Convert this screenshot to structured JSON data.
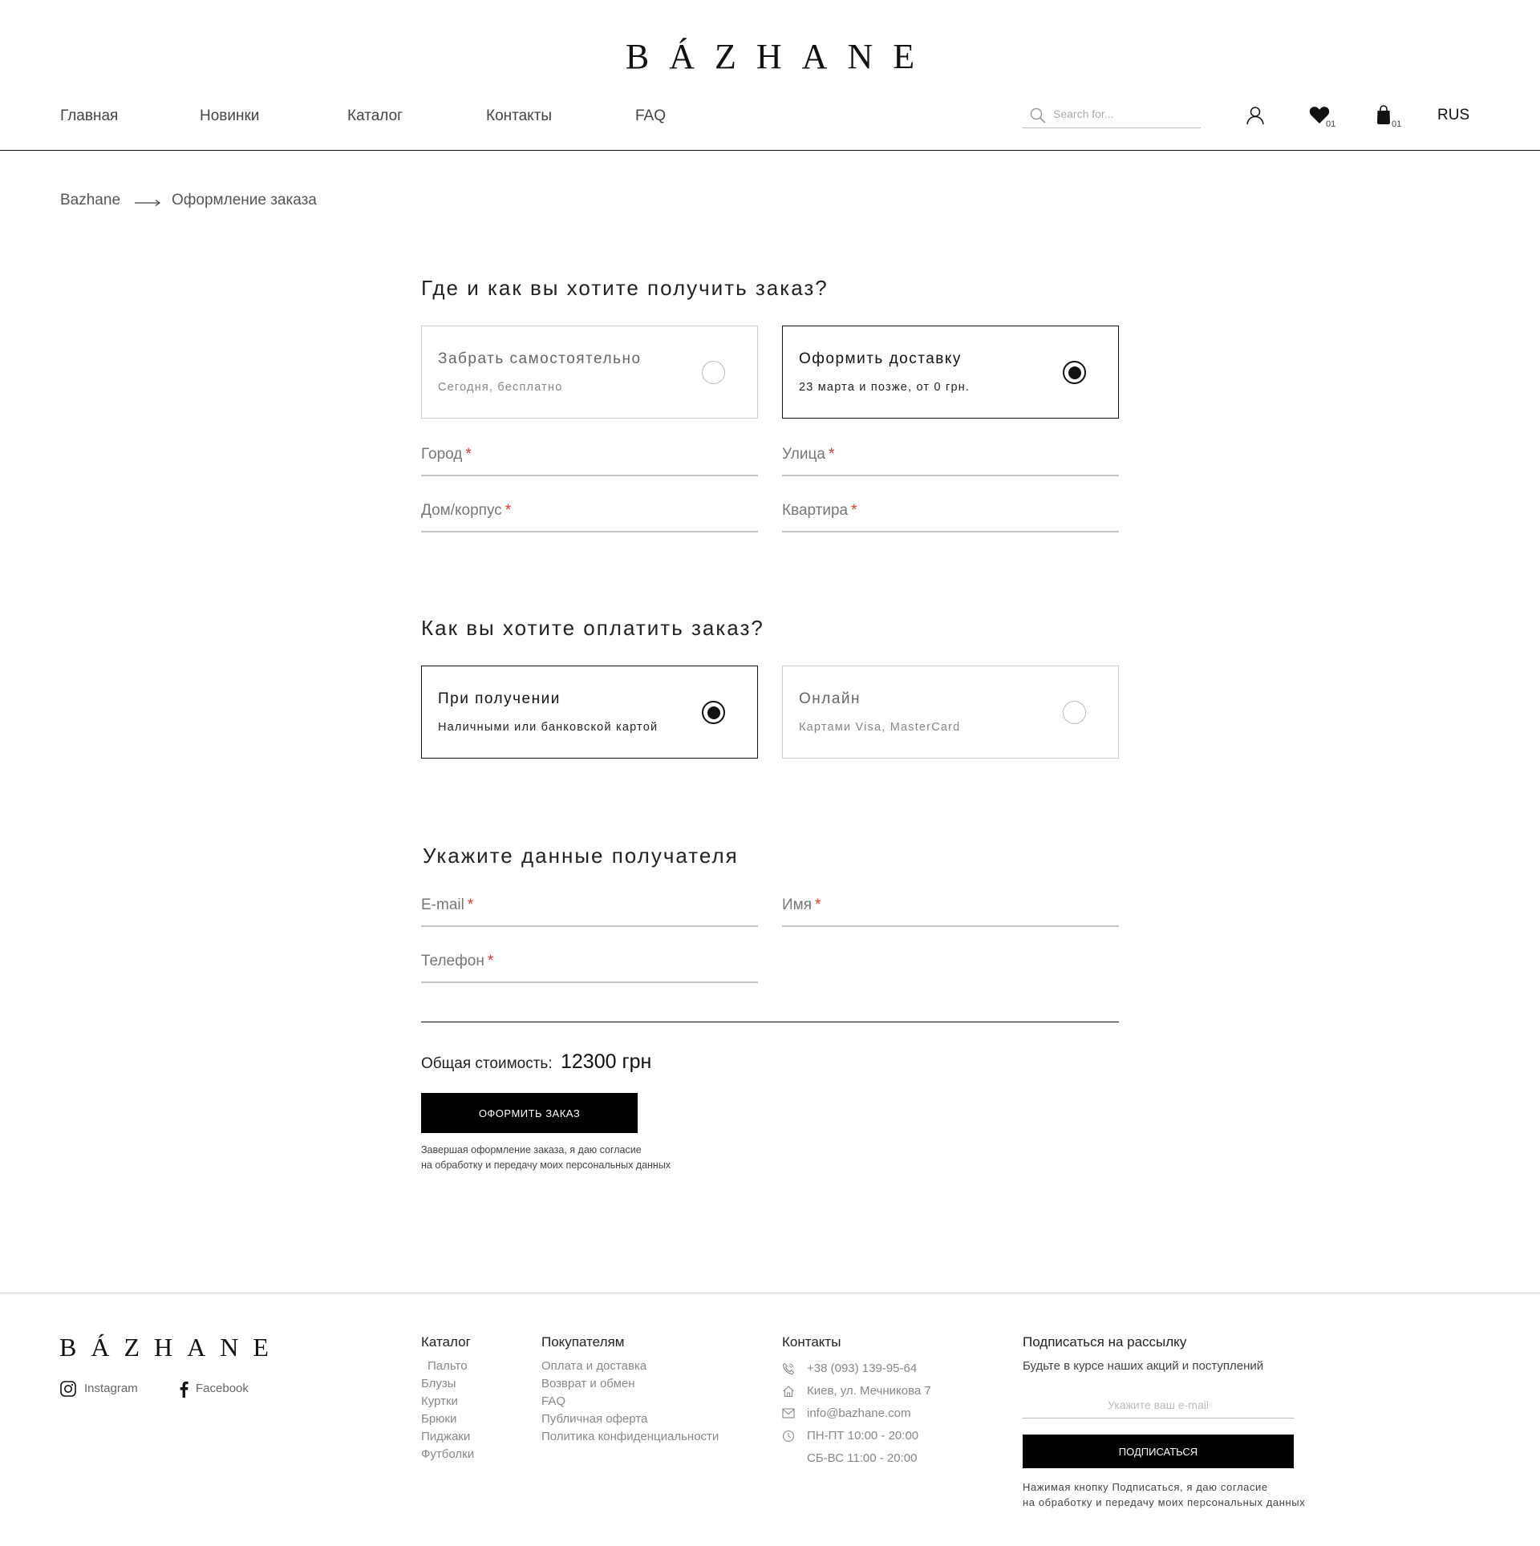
{
  "header": {
    "logo": "BÁZHANE",
    "nav": [
      "Главная",
      "Новинки",
      "Каталог",
      "Контакты",
      "FAQ"
    ],
    "search_placeholder": "Search for...",
    "wishlist_count": "01",
    "cart_count": "01",
    "language": "RUS"
  },
  "breadcrumb": {
    "home": "Bazhane",
    "current": "Оформление заказа"
  },
  "delivery": {
    "heading": "Где и как вы хотите получить заказ?",
    "options": [
      {
        "title": "Забрать самостоятельно",
        "subtitle": "Сегодня, бесплатно",
        "selected": false
      },
      {
        "title": "Оформить доставку",
        "subtitle": "23 марта и позже, от 0 грн.",
        "selected": true
      }
    ],
    "fields": {
      "city": "Город",
      "street": "Улица",
      "house": "Дом/корпус",
      "apartment": "Квартира"
    },
    "required_mark": "*"
  },
  "payment": {
    "heading": "Как вы хотите оплатить заказ?",
    "options": [
      {
        "title": "При получении",
        "subtitle": "Наличными или банковской картой",
        "selected": true
      },
      {
        "title": "Онлайн",
        "subtitle": "Картами Visa, MasterCard",
        "selected": false
      }
    ]
  },
  "recipient": {
    "heading": "Укажите данные получателя",
    "fields": {
      "email": "E-mail",
      "name": "Имя",
      "phone": "Телефон"
    }
  },
  "order": {
    "total_label": "Общая стоимость:",
    "total_value": "12300 грн",
    "submit_label": "ОФОРМИТЬ ЗАКАЗ",
    "consent_line1": "Завершая оформление заказа, я даю согласие",
    "consent_line2": "на обработку и передачу моих персональных данных"
  },
  "footer": {
    "logo": "BÁZHANE",
    "social": {
      "instagram": "Instagram",
      "facebook": "Facebook"
    },
    "catalog": {
      "heading": "Каталог",
      "links": [
        "Пальто",
        "Блузы",
        "Куртки",
        "Брюки",
        "Пиджаки",
        "Футболки"
      ]
    },
    "customers": {
      "heading": "Покупателям",
      "links": [
        "Оплата и доставка",
        "Возврат и обмен",
        "FAQ",
        "Публичная оферта",
        "Политика конфиденциальности"
      ]
    },
    "contacts": {
      "heading": "Контакты",
      "phone": "+38 (093) 139-95-64",
      "address": "Киев, ул. Мечникова 7",
      "email": "info@bazhane.com",
      "hours_weekdays": "ПН-ПТ 10:00 - 20:00",
      "hours_weekend": "СБ-ВС 11:00 - 20:00"
    },
    "newsletter": {
      "heading": "Подписаться на рассылку",
      "subtitle": "Будьте в курсе наших акций и поступлений",
      "placeholder": "Укажите ваш e-mail",
      "button": "ПОДПИСАТЬСЯ",
      "consent_line1": "Нажимая кнопку Подписаться, я даю согласие",
      "consent_line2": "на обработку и передачу моих персональных данных"
    }
  }
}
